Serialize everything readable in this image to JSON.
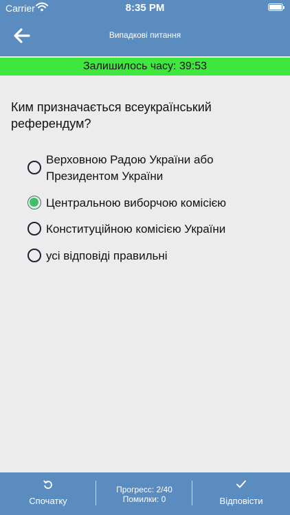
{
  "status_bar": {
    "carrier": "Carrier",
    "time": "8:35 PM"
  },
  "nav": {
    "title": "Випадкові питання",
    "back_icon": "arrow-left-icon"
  },
  "timer": {
    "text": "Залишилось часу: 39:53"
  },
  "question": {
    "text": "Ким призначається всеукраїнський референдум?"
  },
  "options": [
    {
      "label": "Верховною Радою України або Президентом України",
      "selected": false
    },
    {
      "label": "Центральною виборчою комісією",
      "selected": true
    },
    {
      "label": "Конституційною комісією України",
      "selected": false
    },
    {
      "label": "усі відповіді правильні",
      "selected": false
    }
  ],
  "footer": {
    "restart_label": "Спочатку",
    "restart_icon": "rotate-ccw-icon",
    "progress_text": "Прогресс: 2/40",
    "errors_text": "Помилки: 0",
    "answer_label": "Відповісти",
    "answer_icon": "checkmark-icon"
  },
  "colors": {
    "bar": "#5b8cbf",
    "timer": "#3ee63e",
    "selected": "#3fbf6a",
    "background": "#ececec"
  }
}
